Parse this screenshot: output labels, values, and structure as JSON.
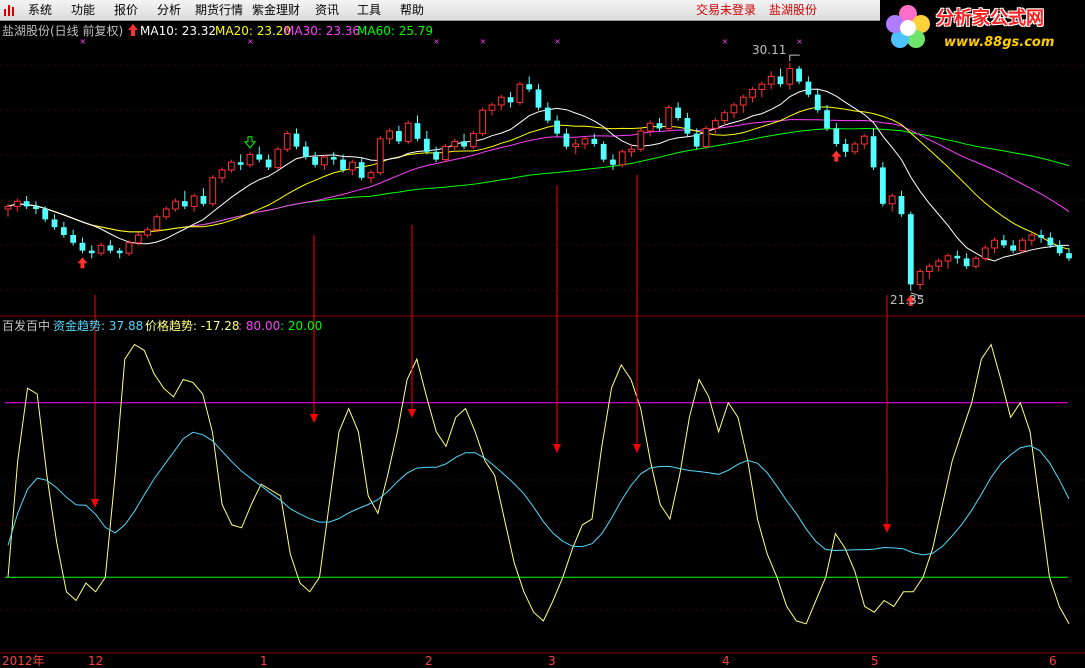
{
  "menu": {
    "items": [
      "系统",
      "功能",
      "报价",
      "分析",
      "期货行情",
      "紫金理财",
      "资讯",
      "工具",
      "帮助"
    ],
    "status_login": "交易未登录",
    "status_stock": "盐湖股份"
  },
  "brand": {
    "name": "分析家公式网",
    "url": "www.88gs.com"
  },
  "price_panel": {
    "title": "盐湖股份(日线 前复权)",
    "ma": [
      {
        "label": "MA10: 23.32",
        "color": "#ffffff"
      },
      {
        "label": "MA20: 23.20",
        "color": "#ffff00"
      },
      {
        "label": "MA30: 23.36",
        "color": "#ff40ff"
      },
      {
        "label": "MA60: 25.79",
        "color": "#00ff00"
      }
    ],
    "high_label": "30.11",
    "low_label": "21.35"
  },
  "indicator_panel": {
    "name": "百发百中",
    "fund_trend": "资金趋势: 37.88",
    "price_trend": "价格趋势: -17.28",
    "level_high": ": 80.00",
    "level_low": ": 20.00"
  },
  "time_axis": {
    "labels": [
      "2012年",
      "12",
      "1",
      "2",
      "3",
      "4",
      "5",
      "6"
    ]
  },
  "colors": {
    "background": "#000000",
    "up_candle": "#ff3232",
    "down_candle": "#54ffff",
    "grid_red": "#8b0000",
    "level_high": "#ff00ff",
    "level_low": "#00ff00",
    "fund_trend": "#54d8ff",
    "price_trend": "#ffff80",
    "signal_arrow": "#ff0000"
  },
  "chart_data": {
    "type": "candlestick",
    "instrument": "盐湖股份",
    "period": "日线 前复权",
    "range_low": 21.35,
    "range_high": 30.11,
    "ma_latest": {
      "MA10": 23.32,
      "MA20": 23.2,
      "MA30": 23.36,
      "MA60": 25.79
    },
    "candles": [
      [
        24.5,
        24.7,
        24.2,
        24.6
      ],
      [
        24.6,
        24.9,
        24.4,
        24.8
      ],
      [
        24.8,
        25.0,
        24.5,
        24.6
      ],
      [
        24.6,
        24.8,
        24.3,
        24.5
      ],
      [
        24.5,
        24.6,
        24.0,
        24.1
      ],
      [
        24.1,
        24.3,
        23.7,
        23.8
      ],
      [
        23.8,
        24.0,
        23.4,
        23.5
      ],
      [
        23.5,
        23.7,
        23.1,
        23.2
      ],
      [
        23.2,
        23.4,
        22.8,
        22.9
      ],
      [
        22.9,
        23.1,
        22.6,
        22.8
      ],
      [
        22.8,
        23.2,
        22.7,
        23.1
      ],
      [
        23.1,
        23.3,
        22.8,
        22.9
      ],
      [
        22.9,
        23.0,
        22.6,
        22.8
      ],
      [
        22.8,
        23.3,
        22.7,
        23.2
      ],
      [
        23.2,
        23.6,
        23.1,
        23.5
      ],
      [
        23.5,
        23.8,
        23.4,
        23.7
      ],
      [
        23.7,
        24.3,
        23.6,
        24.2
      ],
      [
        24.2,
        24.6,
        24.1,
        24.5
      ],
      [
        24.5,
        24.9,
        24.4,
        24.8
      ],
      [
        24.8,
        25.2,
        24.5,
        24.6
      ],
      [
        24.6,
        25.1,
        24.4,
        25.0
      ],
      [
        25.0,
        25.3,
        24.6,
        24.7
      ],
      [
        24.7,
        25.8,
        24.6,
        25.7
      ],
      [
        25.7,
        26.1,
        25.5,
        26.0
      ],
      [
        26.0,
        26.4,
        25.9,
        26.3
      ],
      [
        26.3,
        26.6,
        26.0,
        26.2
      ],
      [
        26.2,
        26.7,
        26.1,
        26.6
      ],
      [
        26.6,
        26.9,
        26.3,
        26.4
      ],
      [
        26.4,
        26.6,
        26.0,
        26.1
      ],
      [
        26.1,
        26.9,
        26.0,
        26.8
      ],
      [
        26.8,
        27.5,
        26.7,
        27.4
      ],
      [
        27.4,
        27.6,
        26.8,
        26.9
      ],
      [
        26.9,
        27.1,
        26.4,
        26.5
      ],
      [
        26.5,
        26.7,
        26.1,
        26.2
      ],
      [
        26.2,
        26.6,
        26.0,
        26.5
      ],
      [
        26.5,
        26.7,
        26.2,
        26.4
      ],
      [
        26.4,
        26.6,
        25.9,
        26.0
      ],
      [
        26.0,
        26.4,
        25.8,
        26.3
      ],
      [
        26.3,
        26.5,
        25.6,
        25.7
      ],
      [
        25.7,
        26.0,
        25.5,
        25.9
      ],
      [
        25.9,
        27.3,
        25.8,
        27.2
      ],
      [
        27.2,
        27.6,
        27.0,
        27.5
      ],
      [
        27.5,
        27.7,
        27.0,
        27.1
      ],
      [
        27.1,
        27.9,
        27.0,
        27.8
      ],
      [
        27.8,
        28.1,
        27.1,
        27.2
      ],
      [
        27.2,
        27.5,
        26.6,
        26.7
      ],
      [
        26.7,
        26.9,
        26.3,
        26.4
      ],
      [
        26.4,
        27.0,
        26.3,
        26.9
      ],
      [
        26.9,
        27.2,
        26.7,
        27.1
      ],
      [
        27.1,
        27.4,
        26.8,
        26.9
      ],
      [
        26.9,
        27.5,
        26.8,
        27.4
      ],
      [
        27.4,
        28.4,
        27.3,
        28.3
      ],
      [
        28.3,
        28.6,
        28.1,
        28.5
      ],
      [
        28.5,
        28.9,
        28.3,
        28.8
      ],
      [
        28.8,
        29.0,
        28.4,
        28.6
      ],
      [
        28.6,
        29.4,
        28.5,
        29.3
      ],
      [
        29.3,
        29.6,
        29.0,
        29.1
      ],
      [
        29.1,
        29.3,
        28.3,
        28.4
      ],
      [
        28.4,
        28.6,
        27.8,
        27.9
      ],
      [
        27.9,
        28.1,
        27.3,
        27.4
      ],
      [
        27.4,
        27.6,
        26.8,
        26.9
      ],
      [
        26.9,
        27.2,
        26.6,
        27.0
      ],
      [
        27.0,
        27.3,
        26.8,
        27.2
      ],
      [
        27.2,
        27.4,
        26.9,
        27.0
      ],
      [
        27.0,
        27.1,
        26.3,
        26.4
      ],
      [
        26.4,
        26.6,
        26.0,
        26.2
      ],
      [
        26.2,
        26.8,
        26.1,
        26.7
      ],
      [
        26.7,
        27.0,
        26.5,
        26.8
      ],
      [
        26.8,
        27.6,
        26.7,
        27.5
      ],
      [
        27.5,
        27.9,
        27.3,
        27.8
      ],
      [
        27.8,
        28.0,
        27.5,
        27.6
      ],
      [
        27.6,
        28.5,
        27.5,
        28.4
      ],
      [
        28.4,
        28.6,
        27.9,
        28.0
      ],
      [
        28.0,
        28.2,
        27.3,
        27.4
      ],
      [
        27.4,
        27.6,
        26.8,
        26.9
      ],
      [
        26.9,
        27.7,
        26.8,
        27.6
      ],
      [
        27.6,
        28.0,
        27.4,
        27.9
      ],
      [
        27.9,
        28.3,
        27.7,
        28.2
      ],
      [
        28.2,
        28.6,
        28.0,
        28.5
      ],
      [
        28.5,
        28.9,
        28.2,
        28.8
      ],
      [
        28.8,
        29.2,
        28.6,
        29.1
      ],
      [
        29.1,
        29.4,
        28.8,
        29.3
      ],
      [
        29.3,
        29.8,
        29.1,
        29.6
      ],
      [
        29.6,
        29.9,
        29.2,
        29.3
      ],
      [
        29.3,
        30.11,
        29.1,
        29.9
      ],
      [
        29.9,
        30.0,
        29.3,
        29.4
      ],
      [
        29.4,
        29.6,
        28.8,
        28.9
      ],
      [
        28.9,
        29.1,
        28.2,
        28.3
      ],
      [
        28.3,
        28.5,
        27.5,
        27.6
      ],
      [
        27.6,
        27.8,
        26.9,
        27.0
      ],
      [
        27.0,
        27.2,
        26.5,
        26.7
      ],
      [
        26.7,
        27.1,
        26.6,
        27.0
      ],
      [
        27.0,
        27.4,
        26.8,
        27.3
      ],
      [
        27.3,
        27.6,
        26.0,
        26.1
      ],
      [
        26.1,
        26.3,
        24.6,
        24.7
      ],
      [
        24.7,
        25.1,
        24.4,
        25.0
      ],
      [
        25.0,
        25.2,
        24.2,
        24.3
      ],
      [
        24.3,
        24.4,
        21.35,
        21.6
      ],
      [
        21.6,
        22.2,
        21.4,
        22.1
      ],
      [
        22.1,
        22.4,
        21.8,
        22.3
      ],
      [
        22.3,
        22.6,
        22.1,
        22.5
      ],
      [
        22.5,
        22.8,
        22.2,
        22.7
      ],
      [
        22.7,
        22.9,
        22.4,
        22.6
      ],
      [
        22.6,
        22.8,
        22.2,
        22.3
      ],
      [
        22.3,
        22.7,
        22.2,
        22.6
      ],
      [
        22.6,
        23.1,
        22.5,
        23.0
      ],
      [
        23.0,
        23.4,
        22.8,
        23.3
      ],
      [
        23.3,
        23.5,
        23.0,
        23.1
      ],
      [
        23.1,
        23.3,
        22.8,
        22.9
      ],
      [
        22.9,
        23.4,
        22.8,
        23.3
      ],
      [
        23.3,
        23.6,
        23.1,
        23.5
      ],
      [
        23.5,
        23.7,
        23.2,
        23.4
      ],
      [
        23.4,
        23.6,
        23.0,
        23.1
      ],
      [
        23.1,
        23.3,
        22.7,
        22.8
      ],
      [
        22.8,
        23.0,
        22.5,
        22.6
      ]
    ],
    "indicator": {
      "name": "百发百中",
      "fund_trend_latest": 37.88,
      "price_trend_latest": -17.28,
      "levels": [
        80,
        20
      ],
      "price_trend": [
        20,
        60,
        85,
        83,
        55,
        32,
        15,
        12,
        18,
        15,
        20,
        55,
        95,
        100,
        98,
        90,
        85,
        82,
        88,
        87,
        83,
        70,
        45,
        38,
        37,
        45,
        52,
        50,
        48,
        28,
        18,
        15,
        20,
        45,
        70,
        78,
        70,
        48,
        42,
        55,
        70,
        88,
        95,
        82,
        70,
        65,
        75,
        78,
        70,
        60,
        55,
        40,
        25,
        15,
        8,
        5,
        12,
        20,
        30,
        38,
        40,
        65,
        85,
        93,
        88,
        78,
        60,
        45,
        40,
        55,
        75,
        88,
        82,
        70,
        80,
        75,
        60,
        40,
        28,
        20,
        10,
        5,
        4,
        12,
        20,
        35,
        30,
        22,
        10,
        8,
        12,
        10,
        15,
        15,
        20,
        30,
        45,
        60,
        70,
        80,
        95,
        100,
        88,
        75,
        80,
        70,
        45,
        20,
        10,
        4
      ]
    },
    "signals": [
      {
        "index": 8
      },
      {
        "index": 27
      },
      {
        "index": 36
      },
      {
        "index": 50
      },
      {
        "index": 57
      },
      {
        "index": 80
      }
    ]
  }
}
